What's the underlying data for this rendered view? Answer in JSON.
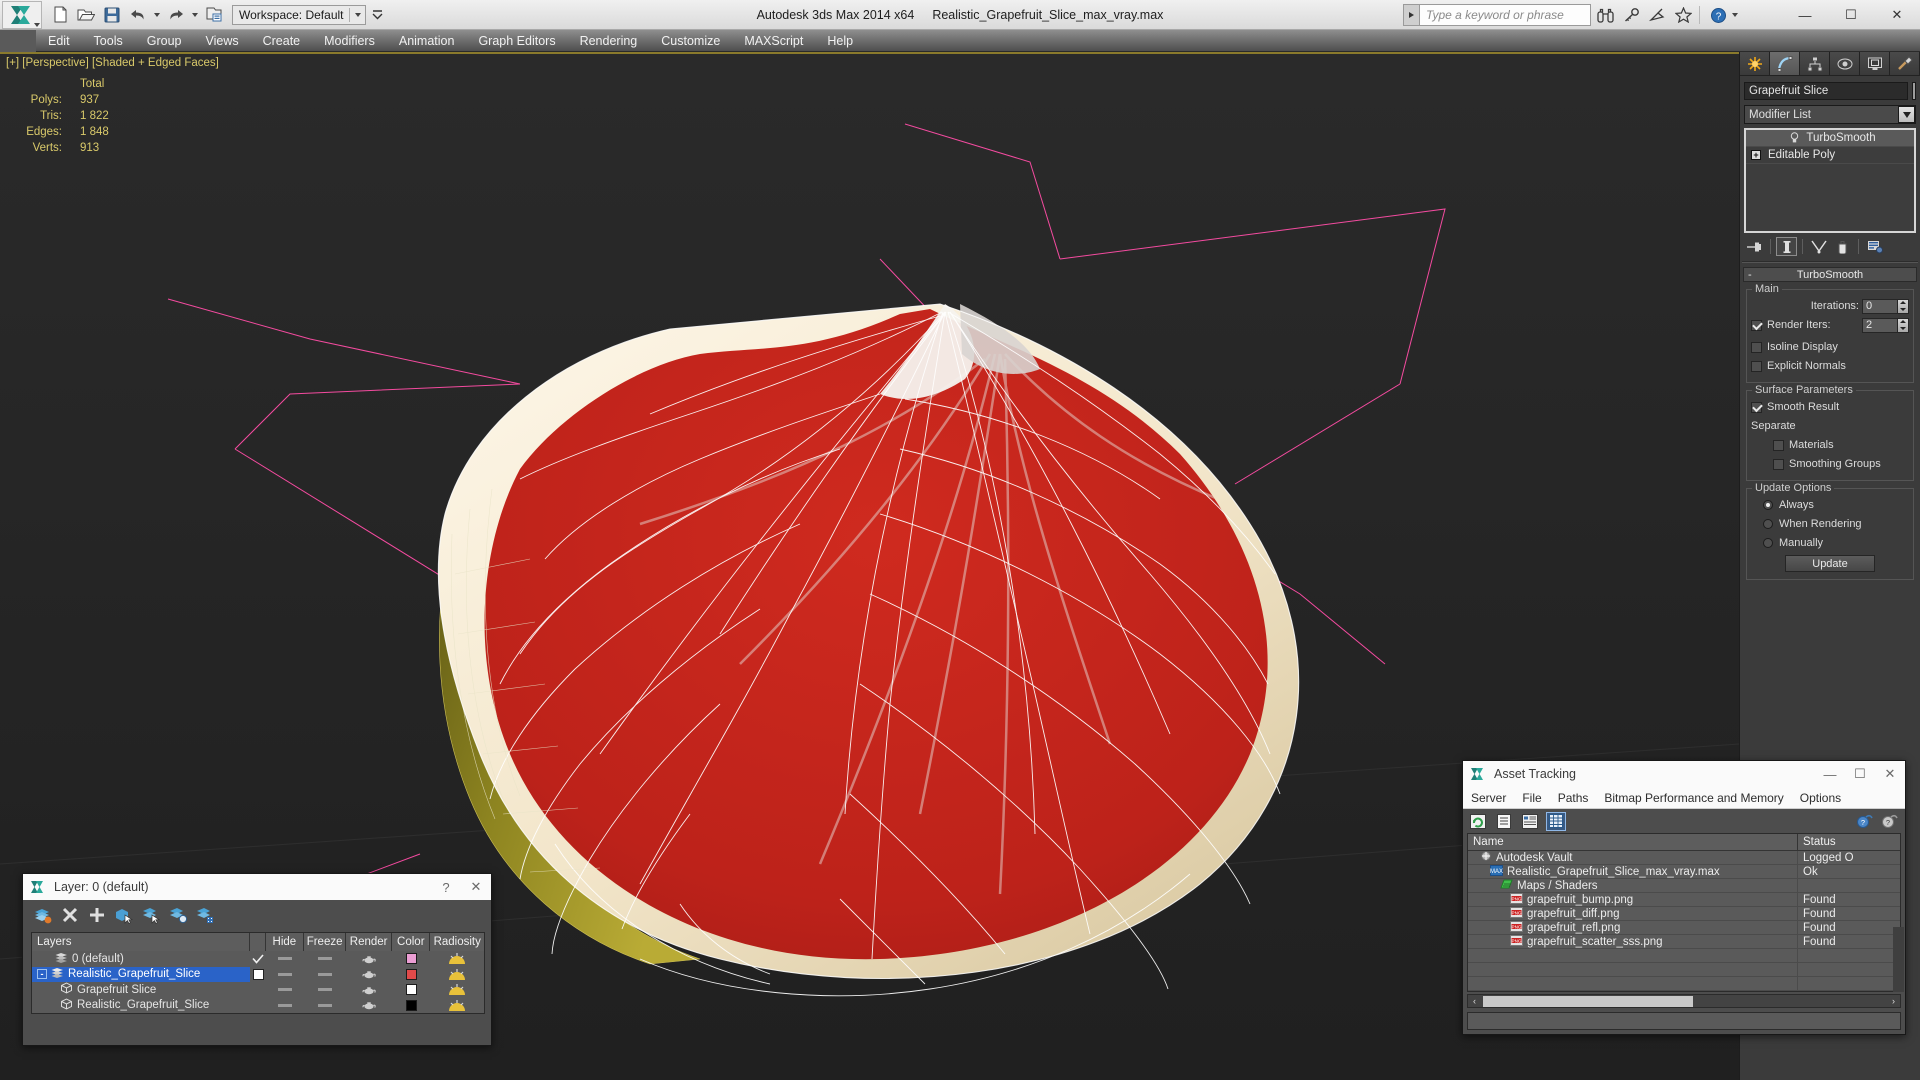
{
  "window": {
    "app_title": "Autodesk 3ds Max  2014 x64",
    "file_title": "Realistic_Grapefruit_Slice_max_vray.max",
    "minimize": "—",
    "maximize": "☐",
    "close": "✕"
  },
  "quick_access": {
    "workspace_label": "Workspace: Default",
    "items": [
      "new-file-icon",
      "open-file-icon",
      "save-file-icon",
      "undo-icon",
      "redo-icon",
      "set-project-folder-icon"
    ]
  },
  "search": {
    "placeholder": "Type a keyword or phrase",
    "icons": [
      "binoculars-icon",
      "key-icon",
      "satellite-dish-icon",
      "star-icon",
      "help-icon"
    ]
  },
  "menubar": {
    "items": [
      "Edit",
      "Tools",
      "Group",
      "Views",
      "Create",
      "Modifiers",
      "Animation",
      "Graph Editors",
      "Rendering",
      "Customize",
      "MAXScript",
      "Help"
    ]
  },
  "viewport": {
    "label": "[+] [Perspective] [Shaded + Edged Faces]",
    "stats_header": "Total",
    "stats": [
      {
        "label": "Polys:",
        "value": "937"
      },
      {
        "label": "Tris:",
        "value": "1 822"
      },
      {
        "label": "Edges:",
        "value": "1 848"
      },
      {
        "label": "Verts:",
        "value": "913"
      }
    ],
    "colors": {
      "background": "#262626",
      "flesh": "#c0231c",
      "pith": "#f3e6cd",
      "rind": "#8b7d1f",
      "wireframe": "#ffffff",
      "helper_lines": "#ff4da6",
      "stats_text": "#d9c96a"
    }
  },
  "command_panel": {
    "tabs": [
      "create-tab",
      "modify-tab",
      "hierarchy-tab",
      "motion-tab",
      "display-tab",
      "utilities-tab"
    ],
    "active_tab": "modify-tab",
    "object_name": "Grapefruit Slice",
    "modifier_list_label": "Modifier List",
    "stack": [
      {
        "label": "TurboSmooth",
        "selected": true
      },
      {
        "label": "Editable Poly",
        "selected": false
      }
    ],
    "stack_tools": [
      "pin-stack-icon",
      "show-end-result-icon",
      "make-unique-icon",
      "remove-modifier-icon",
      "configure-modifier-sets-icon"
    ],
    "rollout": {
      "title": "TurboSmooth",
      "minus": "-",
      "groups": {
        "main": {
          "label": "Main",
          "iterations_label": "Iterations:",
          "iterations_value": "0",
          "render_iters_label": "Render Iters:",
          "render_iters_value": "2",
          "render_iters_checked": true,
          "isoline_display_label": "Isoline Display",
          "isoline_display_checked": false,
          "explicit_normals_label": "Explicit Normals",
          "explicit_normals_checked": false
        },
        "surface": {
          "label": "Surface Parameters",
          "smooth_result_label": "Smooth Result",
          "smooth_result_checked": true,
          "separate_label": "Separate",
          "materials_label": "Materials",
          "materials_checked": false,
          "smoothing_groups_label": "Smoothing Groups",
          "smoothing_groups_checked": false
        },
        "update": {
          "label": "Update Options",
          "always_label": "Always",
          "when_rendering_label": "When Rendering",
          "manually_label": "Manually",
          "selected": "Always",
          "update_button": "Update"
        }
      }
    }
  },
  "layer_dialog": {
    "title": "Layer: 0 (default)",
    "help": "?",
    "close": "✕",
    "toolbar": [
      "new-layer-icon",
      "delete-layer-icon",
      "add-layer-icon",
      "select-objects-in-layer-icon",
      "select-highlighted-objects-icon",
      "highlight-selected-objects-icon",
      "hide-unselected-icon"
    ],
    "columns": [
      "Layers",
      "",
      "Hide",
      "Freeze",
      "Render",
      "Color",
      "Radiosity"
    ],
    "rows": [
      {
        "name": "0 (default)",
        "indent": 0,
        "kind": "layer",
        "current": true,
        "hide": "",
        "freeze": "",
        "color": "#ec9ed4",
        "selected": false,
        "expander": ""
      },
      {
        "name": "Realistic_Grapefruit_Slice",
        "indent": 0,
        "kind": "layer",
        "current": false,
        "hide": "",
        "freeze": "",
        "color": "#e04a4a",
        "selected": true,
        "expander": "-"
      },
      {
        "name": "Grapefruit Slice",
        "indent": 1,
        "kind": "object",
        "current": false,
        "hide": "",
        "freeze": "",
        "color": "#ffffff",
        "selected": false,
        "expander": ""
      },
      {
        "name": "Realistic_Grapefruit_Slice",
        "indent": 1,
        "kind": "object",
        "current": false,
        "hide": "",
        "freeze": "",
        "color": "#000000",
        "selected": false,
        "expander": ""
      }
    ]
  },
  "asset_tracking": {
    "title": "Asset Tracking",
    "minimize": "—",
    "maximize": "☐",
    "close": "✕",
    "menu": [
      "Server",
      "File",
      "Paths",
      "Bitmap Performance and Memory",
      "Options"
    ],
    "toolbar": [
      "refresh-icon",
      "list-view-icon",
      "detail-view-icon",
      "grid-view-icon"
    ],
    "right_icons": [
      "vault-help-icon",
      "help-icon"
    ],
    "columns": [
      "Name",
      "Status"
    ],
    "rows": [
      {
        "name": "Autodesk Vault",
        "status": "Logged O",
        "indent": 1,
        "icon": "vault-icon"
      },
      {
        "name": "Realistic_Grapefruit_Slice_max_vray.max",
        "status": "Ok",
        "indent": 2,
        "icon": "max-file-icon"
      },
      {
        "name": "Maps / Shaders",
        "status": "",
        "indent": 3,
        "icon": "maps-icon"
      },
      {
        "name": "grapefruit_bump.png",
        "status": "Found",
        "indent": 4,
        "icon": "png-icon"
      },
      {
        "name": "grapefruit_diff.png",
        "status": "Found",
        "indent": 4,
        "icon": "png-icon"
      },
      {
        "name": "grapefruit_refl.png",
        "status": "Found",
        "indent": 4,
        "icon": "png-icon"
      },
      {
        "name": "grapefruit_scatter_sss.png",
        "status": "Found",
        "indent": 4,
        "icon": "png-icon"
      },
      {
        "name": "",
        "status": "",
        "indent": 0,
        "icon": ""
      },
      {
        "name": "",
        "status": "",
        "indent": 0,
        "icon": ""
      },
      {
        "name": "",
        "status": "",
        "indent": 0,
        "icon": ""
      }
    ],
    "hscroll_left": "‹",
    "hscroll_right": "›"
  }
}
